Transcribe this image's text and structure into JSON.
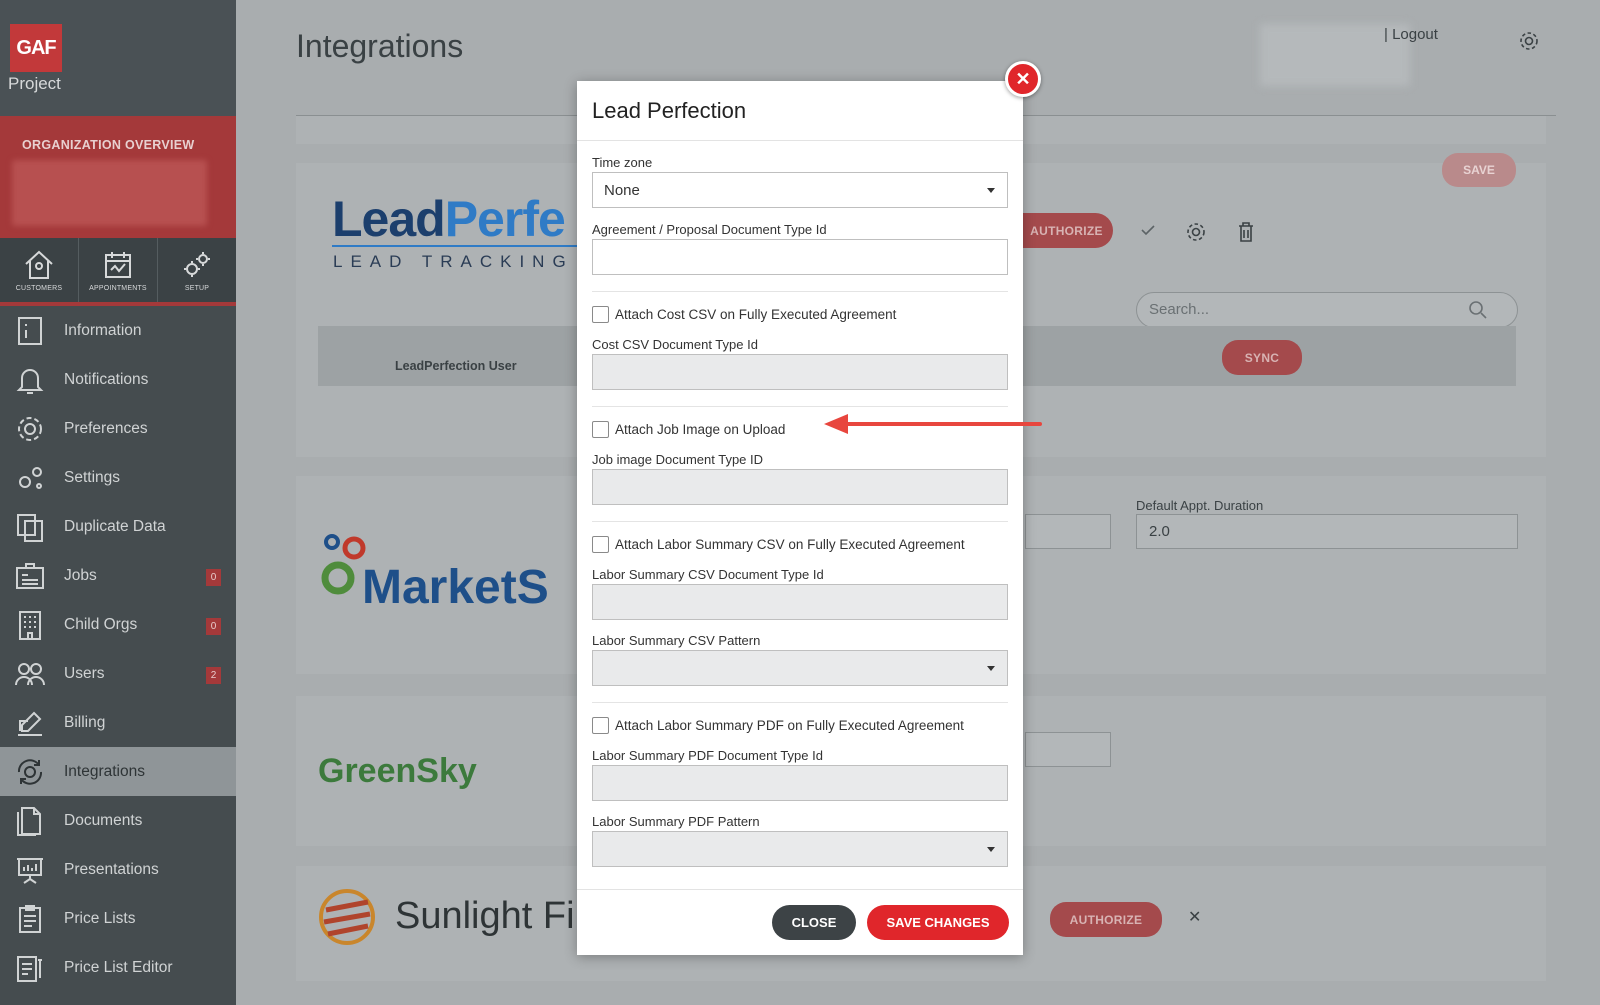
{
  "brand": {
    "logo": "GAF",
    "sub": "Project"
  },
  "org": {
    "title": "ORGANIZATION OVERVIEW"
  },
  "quick_links": [
    {
      "label": "CUSTOMERS"
    },
    {
      "label": "APPOINTMENTS"
    },
    {
      "label": "SETUP"
    }
  ],
  "nav": [
    {
      "label": "Information"
    },
    {
      "label": "Notifications"
    },
    {
      "label": "Preferences"
    },
    {
      "label": "Settings"
    },
    {
      "label": "Duplicate Data"
    },
    {
      "label": "Jobs",
      "badge": "0"
    },
    {
      "label": "Child Orgs",
      "badge": "0"
    },
    {
      "label": "Users",
      "badge": "2"
    },
    {
      "label": "Billing"
    },
    {
      "label": "Integrations"
    },
    {
      "label": "Documents"
    },
    {
      "label": "Presentations"
    },
    {
      "label": "Price Lists"
    },
    {
      "label": "Price List Editor"
    }
  ],
  "page": {
    "title": "Integrations",
    "logout": "| Logout"
  },
  "background": {
    "save": "SAVE",
    "authorize": "AUTHORIZE",
    "search_placeholder": "Search...",
    "table_user_header": "LeadPerfection User",
    "sync": "SYNC",
    "default_duration_label": "Default Appt. Duration",
    "default_duration_value": "2.0",
    "authorize2": "AUTHORIZE",
    "lp_logo_a": "Lead",
    "lp_logo_b": "Perfe",
    "lp_tagline": "LEAD TRACKING S",
    "ms_logo": "MarketS",
    "gs_logo": "GreenSky",
    "sl_logo": "Sunlight Fi"
  },
  "modal": {
    "title": "Lead Perfection",
    "timezone_label": "Time zone",
    "timezone_value": "None",
    "agreement_label": "Agreement / Proposal Document Type Id",
    "attach_cost_csv": "Attach Cost CSV on Fully Executed Agreement",
    "cost_csv_label": "Cost CSV Document Type Id",
    "attach_job_image": "Attach Job Image on Upload",
    "job_image_label": "Job image Document Type ID",
    "attach_labor_csv": "Attach Labor Summary CSV on Fully Executed Agreement",
    "labor_csv_type_label": "Labor Summary CSV Document Type Id",
    "labor_csv_pattern_label": "Labor Summary CSV Pattern",
    "attach_labor_pdf": "Attach Labor Summary PDF on Fully Executed Agreement",
    "labor_pdf_type_label": "Labor Summary PDF Document Type Id",
    "labor_pdf_pattern_label": "Labor Summary PDF Pattern",
    "close_label": "CLOSE",
    "save_label": "SAVE CHANGES"
  },
  "colors": {
    "accent": "#e0262b",
    "sidebar": "#454c4f",
    "brand_red": "#a4393a"
  }
}
